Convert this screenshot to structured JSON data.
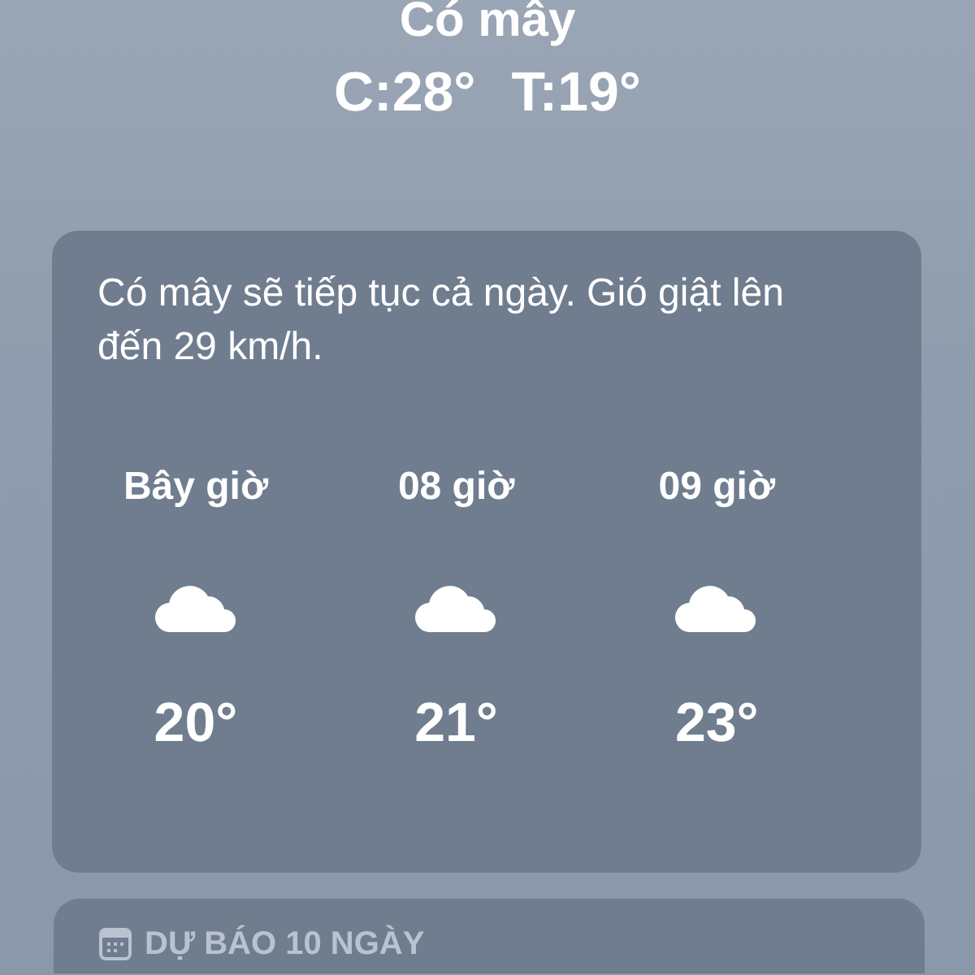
{
  "current": {
    "condition": "Có mây",
    "high": "C:28°",
    "low": "T:19°"
  },
  "hourly_card": {
    "summary": "Có mây sẽ tiếp tục cả ngày. Gió giật lên đến 29 km/h.",
    "hours": [
      {
        "time": "Bây giờ",
        "temp": "20°"
      },
      {
        "time": "08 giờ",
        "temp": "21°"
      },
      {
        "time": "09 giờ",
        "temp": "23°"
      }
    ]
  },
  "daily_card": {
    "title": "DỰ BÁO 10 NGÀY"
  }
}
